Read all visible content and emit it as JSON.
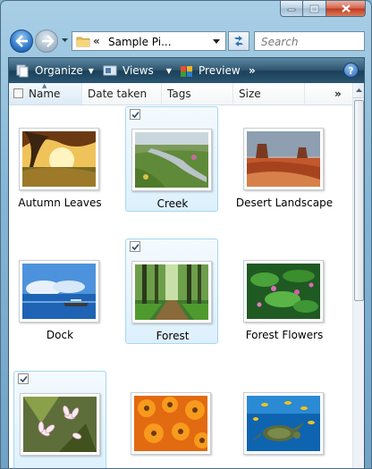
{
  "address_bar": {
    "chevron": "«",
    "path": "Sample Pi...",
    "search_placeholder": "Search"
  },
  "command_bar": {
    "organize_label": "Organize",
    "views_label": "Views",
    "preview_label": "Preview",
    "more_glyph": "»",
    "help_glyph": "?"
  },
  "columns": {
    "name": "Name",
    "date_taken": "Date taken",
    "tags": "Tags",
    "size": "Size",
    "more_glyph": "»"
  },
  "files": [
    {
      "label": "Autumn Leaves",
      "selected": false,
      "thumbnail": "autumn-leaves"
    },
    {
      "label": "Creek",
      "selected": true,
      "thumbnail": "creek"
    },
    {
      "label": "Desert Landscape",
      "selected": false,
      "thumbnail": "desert-landscape"
    },
    {
      "label": "Dock",
      "selected": false,
      "thumbnail": "dock"
    },
    {
      "label": "Forest",
      "selected": true,
      "thumbnail": "forest"
    },
    {
      "label": "Forest Flowers",
      "selected": false,
      "thumbnail": "forest-flowers"
    },
    {
      "label": "",
      "selected": true,
      "thumbnail": "frangipani-flowers"
    },
    {
      "label": "",
      "selected": false,
      "thumbnail": "orange-flowers"
    },
    {
      "label": "",
      "selected": false,
      "thumbnail": "sea-turtle"
    }
  ],
  "colors": {
    "selection_fill": "#dcf0fc",
    "selection_border": "#a6d8f2",
    "command_bar": "#1b405a"
  }
}
